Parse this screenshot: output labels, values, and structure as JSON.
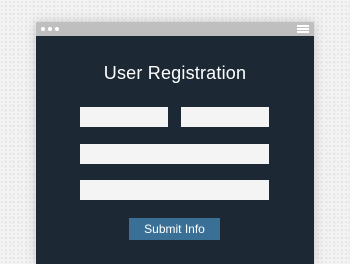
{
  "window": {
    "controls": [
      "dot",
      "dot",
      "dot"
    ],
    "menu_icon": "hamburger-menu-icon"
  },
  "form": {
    "title": "User Registration",
    "fields": {
      "first_name": {
        "value": "",
        "placeholder": ""
      },
      "last_name": {
        "value": "",
        "placeholder": ""
      },
      "email": {
        "value": "",
        "placeholder": ""
      },
      "password": {
        "value": "",
        "placeholder": ""
      }
    },
    "submit_label": "Submit Info"
  },
  "colors": {
    "window_bg": "#1c2833",
    "titlebar": "#bfbfbf",
    "field_bg": "#f4f4f4",
    "button_bg": "#3a6f96",
    "text": "#ffffff"
  }
}
